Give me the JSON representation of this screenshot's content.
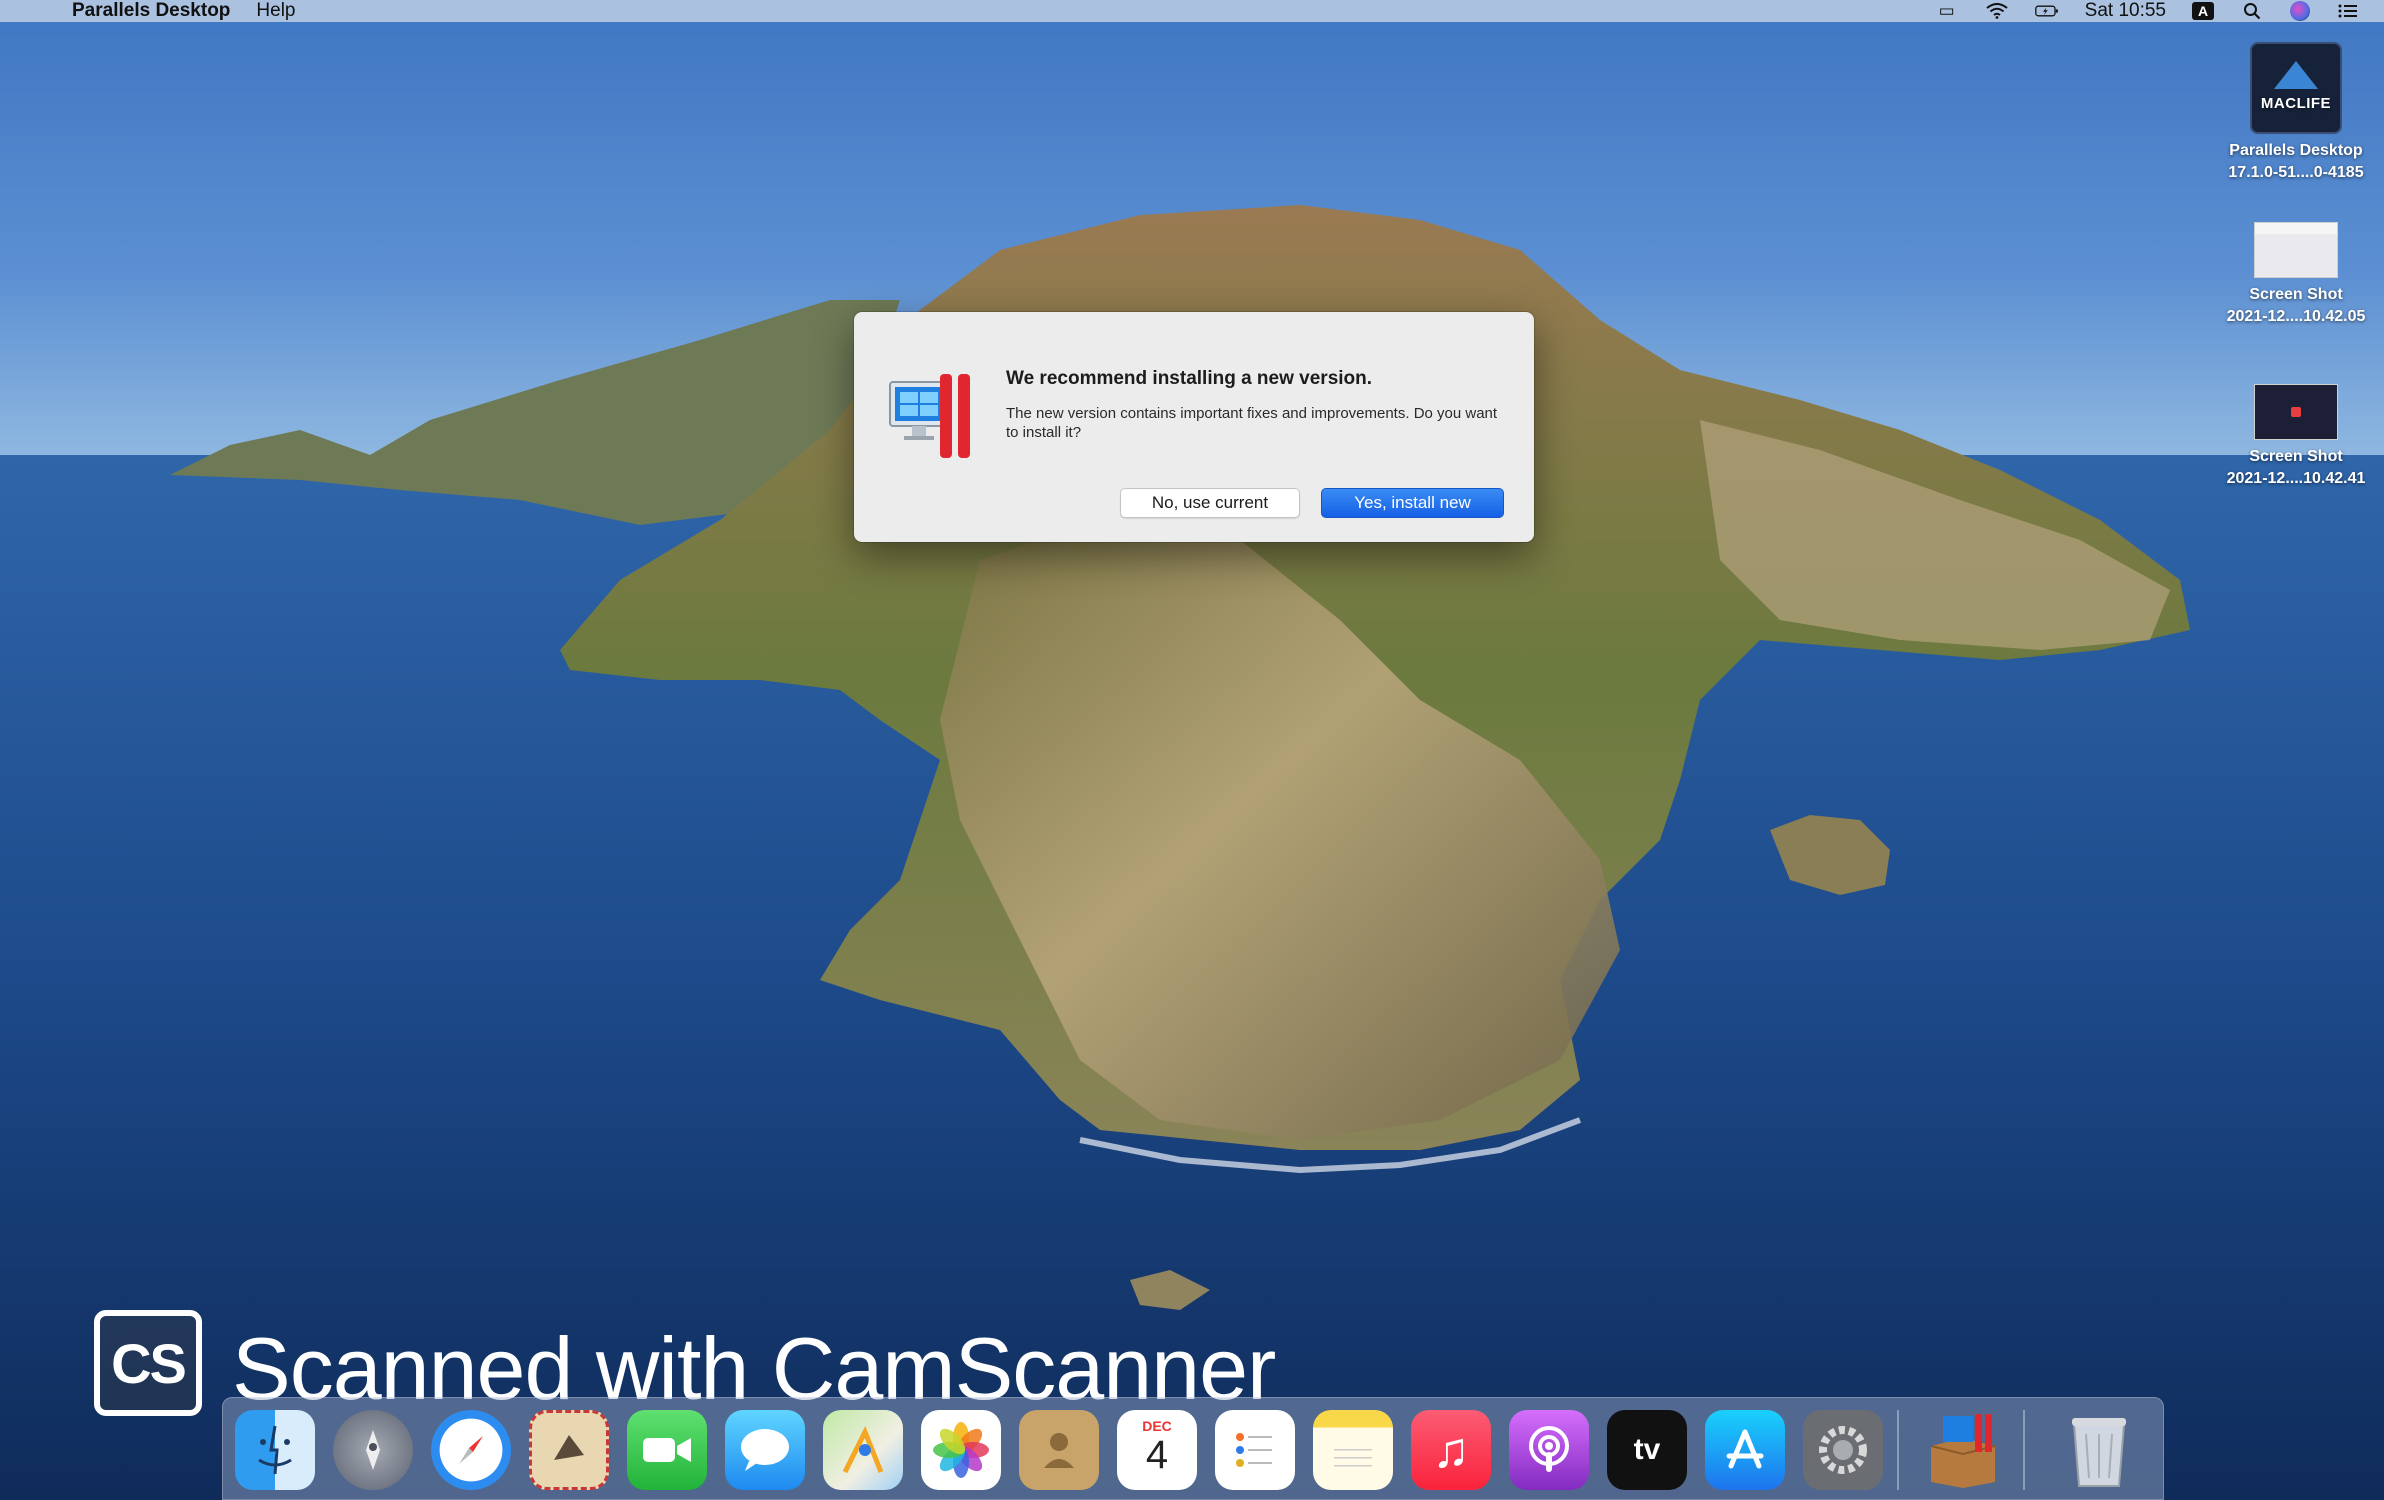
{
  "menubar": {
    "app_name": "Parallels Desktop",
    "menus": [
      "Help"
    ],
    "clock": "Sat 10:55",
    "input_source": "A",
    "status_icons": [
      "airplay-icon",
      "wifi-icon",
      "battery-icon",
      "input-source-icon",
      "spotlight-icon",
      "siri-icon",
      "notification-center-icon"
    ]
  },
  "desktop_items": [
    {
      "label_line1": "Parallels Desktop",
      "label_line2": "17.1.0-51....0-4185",
      "thumb_text": "MACLIFE"
    },
    {
      "label_line1": "Screen Shot",
      "label_line2": "2021-12....10.42.05"
    },
    {
      "label_line1": "Screen Shot",
      "label_line2": "2021-12....10.42.41"
    }
  ],
  "dialog": {
    "title": "We recommend installing a new version.",
    "body": "The new version contains important fixes and improvements. Do you want to install it?",
    "secondary_button": "No, use current",
    "primary_button": "Yes, install new"
  },
  "watermark": {
    "logo_text": "CS",
    "text": "Scanned with CamScanner"
  },
  "dock": {
    "apps": [
      {
        "name": "Finder",
        "icon": "finder-icon"
      },
      {
        "name": "Launchpad",
        "icon": "launchpad-icon"
      },
      {
        "name": "Safari",
        "icon": "safari-icon"
      },
      {
        "name": "Mail",
        "icon": "mail-icon"
      },
      {
        "name": "FaceTime",
        "icon": "facetime-icon"
      },
      {
        "name": "Messages",
        "icon": "messages-icon"
      },
      {
        "name": "Maps",
        "icon": "maps-icon"
      },
      {
        "name": "Photos",
        "icon": "photos-icon"
      },
      {
        "name": "Contacts",
        "icon": "contacts-icon"
      },
      {
        "name": "Calendar",
        "icon": "calendar-icon"
      },
      {
        "name": "Reminders",
        "icon": "reminders-icon"
      },
      {
        "name": "Notes",
        "icon": "notes-icon"
      },
      {
        "name": "Music",
        "icon": "music-icon"
      },
      {
        "name": "Podcasts",
        "icon": "podcasts-icon"
      },
      {
        "name": "TV",
        "icon": "tv-icon"
      },
      {
        "name": "App Store",
        "icon": "app-store-icon"
      },
      {
        "name": "System Preferences",
        "icon": "system-preferences-icon"
      },
      {
        "name": "Parallels Desktop Installer",
        "icon": "parallels-installer-icon"
      },
      {
        "name": "Trash",
        "icon": "trash-icon"
      }
    ],
    "calendar_month": "DEC",
    "calendar_day": "4",
    "tv_label": "tv"
  },
  "colors": {
    "accent": "#1660e6",
    "parallels_red": "#e0262e"
  }
}
